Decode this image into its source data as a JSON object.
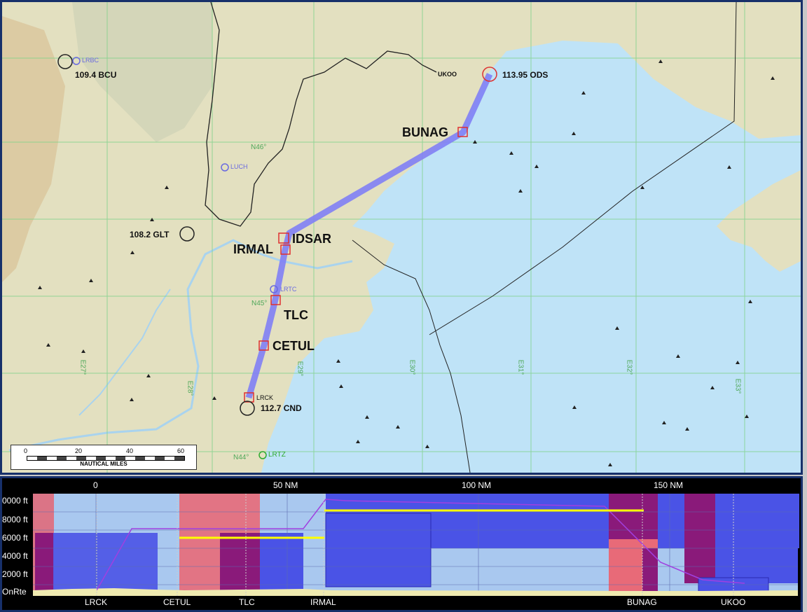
{
  "map": {
    "navaids": [
      {
        "id": "bcu",
        "label": "109.4 BCU",
        "airport": "LRBC"
      },
      {
        "id": "glt",
        "label": "108.2 GLT"
      },
      {
        "id": "ods",
        "label": "113.95 ODS",
        "airport": "UKOO"
      },
      {
        "id": "cnd",
        "label": "112.7 CND",
        "airport": "LRCK"
      }
    ],
    "airports": [
      {
        "id": "luch",
        "label": "LUCH"
      },
      {
        "id": "lrtc",
        "label": "LRTC"
      },
      {
        "id": "lrtz",
        "label": "LRTZ"
      }
    ],
    "waypoints": [
      "BUNAG",
      "IDSAR",
      "IRMAL",
      "TLC",
      "CETUL"
    ],
    "grid_labels": {
      "lat": [
        "N46°",
        "N45°",
        "N44°"
      ],
      "lon": [
        "E27°",
        "E28°",
        "E29°",
        "E30°",
        "E31°",
        "E32°",
        "E33°"
      ]
    },
    "scale": {
      "ticks": [
        "0",
        "20",
        "40",
        "60"
      ],
      "units": "NAUTICAL MILES"
    },
    "colors": {
      "route": "#7f7ff5",
      "land": "#e6e3c4",
      "sea": "#bfe3f7",
      "grid": "#7fd28a"
    }
  },
  "profile": {
    "distance_labels": [
      "0",
      "50 NM",
      "100 NM",
      "150 NM"
    ],
    "altitude_labels": [
      "0000 ft",
      "8000 ft",
      "6000 ft",
      "4000 ft",
      "2000 ft",
      "OnRte"
    ],
    "waypoint_labels": [
      "LRCK",
      "CETUL",
      "TLC",
      "IRMAL",
      "BUNAG",
      "UKOO"
    ]
  }
}
